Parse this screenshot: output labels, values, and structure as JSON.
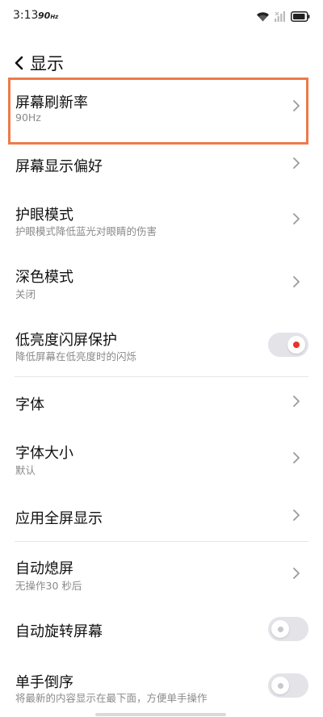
{
  "status_bar": {
    "time": "3:13",
    "refresh_badge": "90",
    "refresh_unit": "Hz"
  },
  "header": {
    "title": "显示"
  },
  "items": [
    {
      "title": "屏幕刷新率",
      "subtitle": "90Hz"
    },
    {
      "title": "屏幕显示偏好"
    },
    {
      "title": "护眼模式",
      "subtitle": "护眼模式降低蓝光对眼睛的伤害"
    },
    {
      "title": "深色模式",
      "subtitle": "关闭"
    },
    {
      "title": "低亮度闪屏保护",
      "subtitle": "降低屏幕在低亮度时的闪烁",
      "toggle": "on"
    },
    {
      "title": "字体"
    },
    {
      "title": "字体大小",
      "subtitle": "默认"
    },
    {
      "title": "应用全屏显示"
    },
    {
      "title": "自动熄屏",
      "subtitle": "无操作30 秒后"
    },
    {
      "title": "自动旋转屏幕",
      "toggle": "off"
    },
    {
      "title": "单手倒序",
      "subtitle": "将最新的内容显示在最下面，方便单手操作",
      "toggle": "off"
    }
  ],
  "colors": {
    "highlight": "#ee7a4a",
    "toggle_on_dot": "#e8322b"
  }
}
